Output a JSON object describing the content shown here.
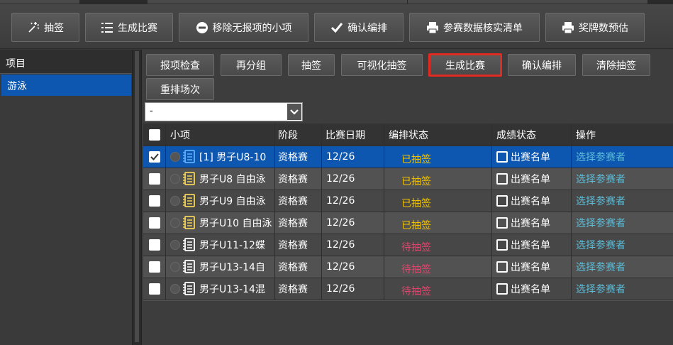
{
  "toolbar": {
    "draw_label": "抽签",
    "generate_label": "生成比赛",
    "remove_label": "移除无报项的小项",
    "confirm_label": "确认编排",
    "verify_label": "参赛数据核实清单",
    "medal_label": "奖牌数预估"
  },
  "left_panel": {
    "header": "项目",
    "items": [
      {
        "label": "游泳"
      }
    ]
  },
  "sub_toolbar": {
    "check_label": "报项检查",
    "regroup_label": "再分组",
    "draw_label": "抽签",
    "visual_draw_label": "可视化抽签",
    "generate_label": "生成比赛",
    "confirm_label": "确认编排",
    "clear_label": "清除抽签",
    "reschedule_label": "重排场次"
  },
  "select": {
    "value": "-"
  },
  "table": {
    "headers": {
      "event": "小项",
      "stage": "阶段",
      "date": "比赛日期",
      "schedule": "编排状态",
      "result": "成绩状态",
      "action": "操作"
    },
    "rows": [
      {
        "event": "[1] 男子U8-10",
        "stage": "资格赛",
        "date": "12/26",
        "schedule": "已抽签",
        "result": "出赛名单",
        "action": "选择参赛者"
      },
      {
        "event": "男子U8 自由泳",
        "stage": "资格赛",
        "date": "12/26",
        "schedule": "已抽签",
        "result": "出赛名单",
        "action": "选择参赛者"
      },
      {
        "event": "男子U9 自由泳",
        "stage": "资格赛",
        "date": "12/26",
        "schedule": "已抽签",
        "result": "出赛名单",
        "action": "选择参赛者"
      },
      {
        "event": "男子U10 自由泳",
        "stage": "资格赛",
        "date": "12/26",
        "schedule": "已抽签",
        "result": "出赛名单",
        "action": "选择参赛者"
      },
      {
        "event": "男子U11-12蝶",
        "stage": "资格赛",
        "date": "12/26",
        "schedule": "待抽签",
        "result": "出赛名单",
        "action": "选择参赛者"
      },
      {
        "event": "男子U13-14自",
        "stage": "资格赛",
        "date": "12/26",
        "schedule": "待抽签",
        "result": "出赛名单",
        "action": "选择参赛者"
      },
      {
        "event": "男子U13-14混",
        "stage": "资格赛",
        "date": "12/26",
        "schedule": "待抽签",
        "result": "出赛名单",
        "action": "选择参赛者"
      }
    ]
  },
  "colors": {
    "selected_row": "#0e57b0",
    "status_done": "#f2c200",
    "status_pending": "#e0456d",
    "link": "#5bbcd8",
    "highlight_border": "#e02a22"
  }
}
